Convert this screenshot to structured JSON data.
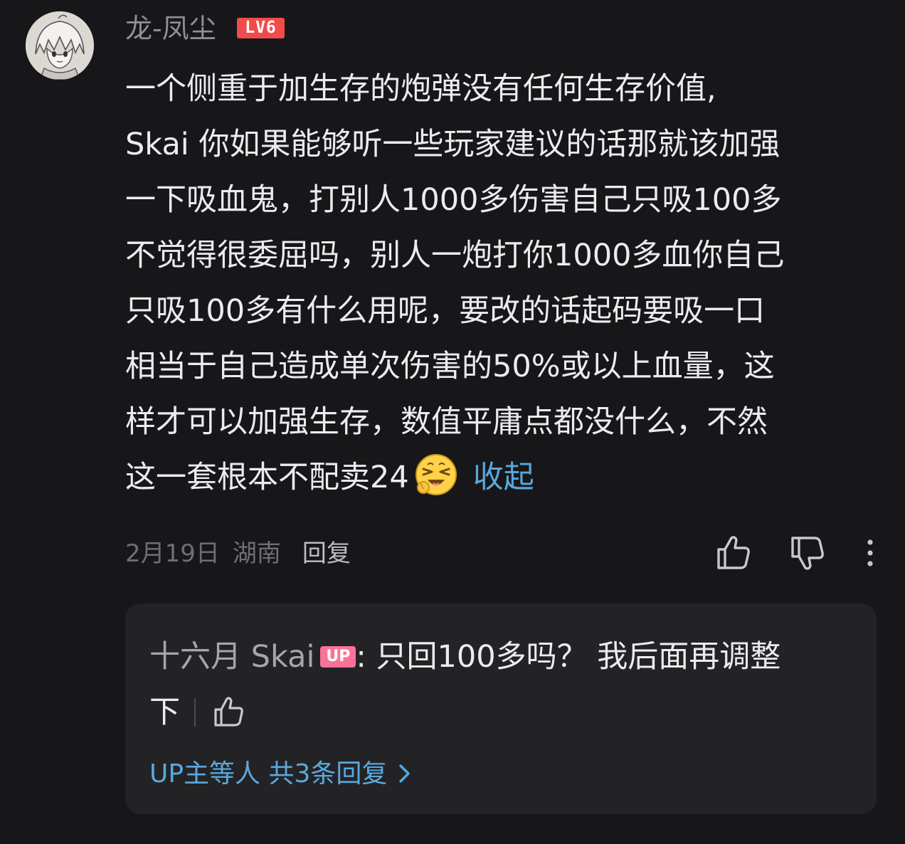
{
  "comment": {
    "username": "龙-凤尘",
    "level_badge": "LV6",
    "body_lines": [
      "一个侧重于加生存的炮弹没有任何生存价值,",
      "Skai 你如果能够听一些玩家建议的话那就该加强",
      "一下吸血鬼，打别人1000多伤害自己只吸100多",
      "不觉得很委屈吗，别人一炮打你1000多血你自己",
      "只吸100多有什么用呢，要改的话起码要吸一口",
      "相当于自己造成单次伤害的50%或以上血量，这",
      "样才可以加强生存，数值平庸点都没什么，不然"
    ],
    "body_last_line": "这一套根本不配卖24",
    "emoji_icon": "laughing-tears-emoji-icon",
    "collapse_label": "收起",
    "date": "2月19日",
    "region": "湖南",
    "reply_label": "回复"
  },
  "reply": {
    "author": "十六月 Skai",
    "author_badge": "UP",
    "text_line1": ": 只回100多吗？ 我后面再调整",
    "text_line2": "下",
    "more_replies_label": "UP主等人 共3条回复"
  },
  "colors": {
    "background": "#17171a",
    "reply_background": "#232326",
    "link": "#5aa8dc",
    "level_badge": "#f24b4b",
    "up_badge": "#fb7299"
  }
}
